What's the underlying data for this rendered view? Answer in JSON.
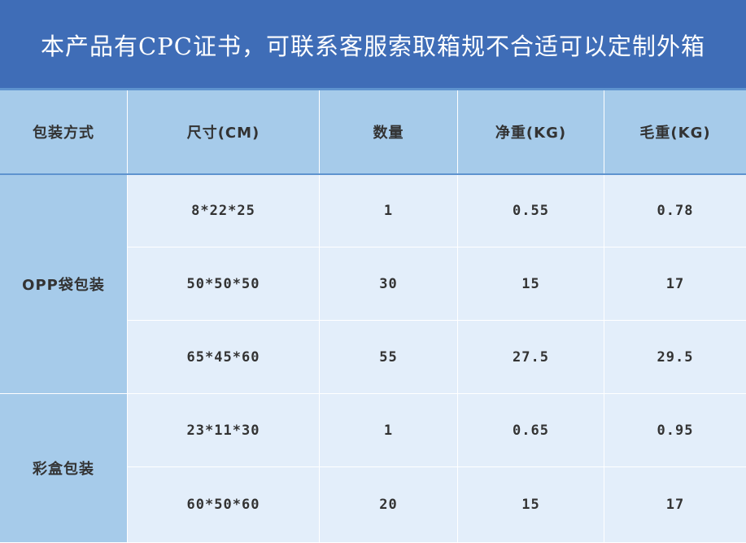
{
  "banner": {
    "text": "本产品有CPC证书，可联系客服索取箱规不合适可以定制外箱"
  },
  "table": {
    "headers": [
      "包装方式",
      "尺寸(CM)",
      "数量",
      "净重(KG)",
      "毛重(KG)"
    ],
    "groups": [
      {
        "label": "OPP袋包装",
        "rows": [
          {
            "size": "8*22*25",
            "qty": "1",
            "net": "0.55",
            "gross": "0.78"
          },
          {
            "size": "50*50*50",
            "qty": "30",
            "net": "15",
            "gross": "17"
          },
          {
            "size": "65*45*60",
            "qty": "55",
            "net": "27.5",
            "gross": "29.5"
          }
        ]
      },
      {
        "label": "彩盒包装",
        "rows": [
          {
            "size": "23*11*30",
            "qty": "1",
            "net": "0.65",
            "gross": "0.95"
          },
          {
            "size": "60*50*60",
            "qty": "20",
            "net": "15",
            "gross": "17"
          }
        ]
      }
    ]
  },
  "colors": {
    "banner_bg": "#3f6db7",
    "header_bg": "#a6cbea",
    "body_bg": "#e3eefa",
    "divider": "#5e93cf"
  }
}
